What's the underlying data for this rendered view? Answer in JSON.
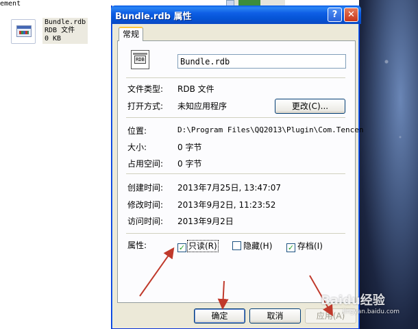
{
  "explorer": {
    "crumb": "ement",
    "file": {
      "name": "Bundle.rdb",
      "type": "RDB 文件",
      "size": "0 KB"
    }
  },
  "dialog": {
    "title": "Bundle.rdb 属性",
    "help_glyph": "?",
    "close_glyph": "✕",
    "tab": "常规",
    "icon_text": "RDB",
    "filename": "Bundle.rdb",
    "rows": {
      "type_label": "文件类型:",
      "type_value": "RDB 文件",
      "opens_label": "打开方式:",
      "opens_value": "未知应用程序",
      "change_button": "更改(C)...",
      "location_label": "位置:",
      "location_value": "D:\\Program Files\\QQ2013\\Plugin\\Com.Tencen",
      "size_label": "大小:",
      "size_value": "0 字节",
      "disk_label": "占用空间:",
      "disk_value": "0 字节",
      "created_label": "创建时间:",
      "created_value": "2013年7月25日, 13:47:07",
      "modified_label": "修改时间:",
      "modified_value": "2013年9月2日, 11:23:52",
      "accessed_label": "访问时间:",
      "accessed_value": "2013年9月2日"
    },
    "attributes": {
      "label": "属性:",
      "readonly": {
        "label": "只读(R)",
        "checked": true
      },
      "hidden": {
        "label": "隐藏(H)",
        "checked": false
      },
      "archive": {
        "label": "存档(I)",
        "checked": true
      }
    },
    "buttons": {
      "ok": "确定",
      "cancel": "取消",
      "apply": "应用(A)"
    }
  },
  "watermark": {
    "brand": "Baidu经验",
    "url": "jingyan.baidu.com"
  },
  "colors": {
    "titlebar": "#0554d6",
    "dialog_bg": "#ece9d8",
    "arrow": "#c0392b",
    "check": "#21a121"
  }
}
